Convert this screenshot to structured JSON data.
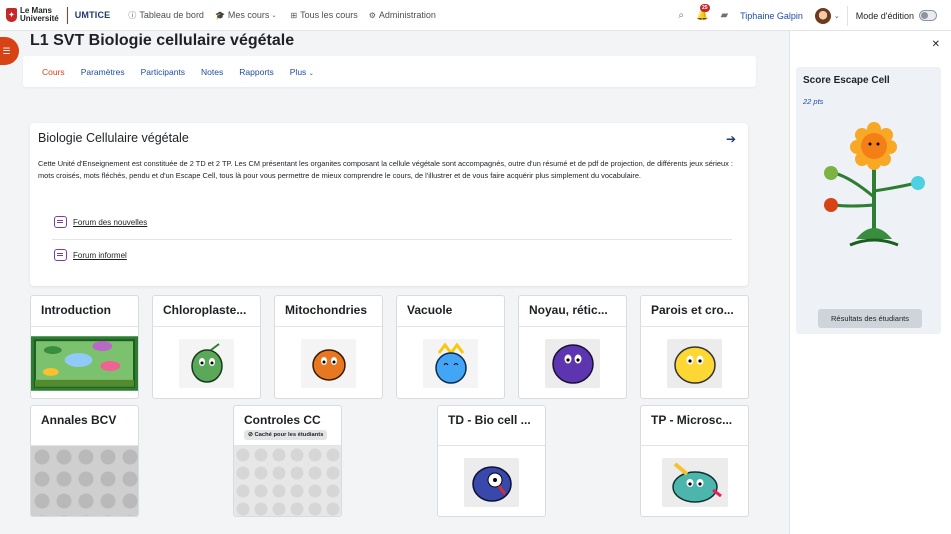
{
  "navbar": {
    "logo_line1": "Le Mans",
    "logo_line2": "Université",
    "brand": "UMTICE",
    "items": [
      {
        "label": "Tableau de bord",
        "icon": "info-circle-icon"
      },
      {
        "label": "Mes cours",
        "icon": "graduation-cap-icon"
      },
      {
        "label": "Tous les cours",
        "icon": "sitemap-icon"
      },
      {
        "label": "Administration",
        "icon": "gear-icon"
      }
    ],
    "notification_count": "25",
    "user_name": "Tiphaine Galpin",
    "edit_mode_label": "Mode d'édition"
  },
  "course": {
    "title": "L1 SVT Biologie cellulaire végétale",
    "tabs": [
      "Cours",
      "Paramètres",
      "Participants",
      "Notes",
      "Rapports",
      "Plus"
    ]
  },
  "summary": {
    "title": "Biologie Cellulaire végétale",
    "text": "Cette Unité d'Enseignement est constituée de 2 TD et 2 TP. Les CM présentant les organites composant la cellule végétale sont accompagnés, outre d'un résumé et de pdf de projection, de différents jeux sérieux : mots croisés, mots fléchés, pendu et d'un Escape Cell, tous là pour vous permettre de mieux comprendre le cours, de l'illustrer et de vous faire acquérir plus simplement du vocabulaire.",
    "forums": [
      "Forum des nouvelles",
      "Forum informel"
    ]
  },
  "tiles": [
    {
      "title": "Introduction"
    },
    {
      "title": "Chloroplaste..."
    },
    {
      "title": "Mitochondries"
    },
    {
      "title": "Vacuole"
    },
    {
      "title": "Noyau, rétic..."
    },
    {
      "title": "Parois et cro..."
    },
    {
      "title": "Annales BCV"
    },
    {
      "title": "Controles CC",
      "badge": "Caché pour les étudiants"
    },
    {
      "title": "TD - Bio cell ..."
    },
    {
      "title": "TP - Microsc..."
    }
  ],
  "drawer": {
    "block_title": "Score Escape Cell",
    "points": "22 pts",
    "button": "Résultats des étudiants"
  },
  "colors": {
    "accent": "#d84315",
    "link": "#1e4da1",
    "brand": "#1e3a6e"
  }
}
